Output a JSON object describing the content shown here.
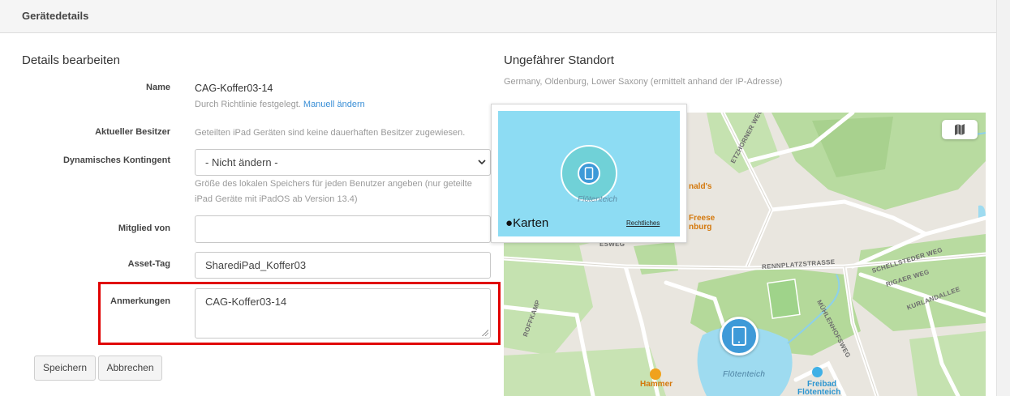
{
  "header": {
    "title": "Gerätedetails"
  },
  "details": {
    "title": "Details bearbeiten",
    "name": {
      "label": "Name",
      "value": "CAG-Koffer03-14",
      "help": "Durch Richtlinie festgelegt.",
      "link": "Manuell ändern"
    },
    "owner": {
      "label": "Aktueller Besitzer",
      "help": "Geteilten iPad Geräten sind keine dauerhaften Besitzer zugewiesen."
    },
    "quota": {
      "label": "Dynamisches Kontingent",
      "value": "- Nicht ändern -",
      "help_line1": "Größe des lokalen Speichers für jeden Benutzer angeben (nur geteilte",
      "help_line2": "iPad Geräte mit iPadOS ab Version 13.4)"
    },
    "member": {
      "label": "Mitglied von",
      "value": ""
    },
    "asset": {
      "label": "Asset-Tag",
      "value": "SharediPad_Koffer03"
    },
    "notes": {
      "label": "Anmerkungen",
      "value": "CAG-Koffer03-14"
    },
    "save_label": "Speichern",
    "cancel_label": "Abbrechen"
  },
  "location": {
    "title": "Ungefährer Standort",
    "subtitle": "Germany, Oldenburg, Lower Saxony (ermittelt anhand der IP-Adresse)",
    "popup": {
      "water_label": "Flötenteich",
      "brand": "Karten",
      "legal": "Rechtliches"
    },
    "map_labels": {
      "etzhorner": "ETZHORNER WEG",
      "schellsteder": "SCHELLSTEDER WEG",
      "rigaer": "RIGAER WEG",
      "kurlandallee": "KURLANDALLEE",
      "rennplatz": "RENNPLATZSTRASSE",
      "muehlenhofsweg": "MÜHLENHOFSWEG",
      "roffkamp": "ROFFKAMP",
      "lake": "Flötenteich",
      "mcdonalds": "nald's",
      "freese1": "Freese",
      "freese2": "nburg",
      "hammer": "Hammer",
      "freibad1": "Freibad",
      "freibad2": "Flötenteich",
      "strasse_partial": "ESWEG"
    }
  }
}
